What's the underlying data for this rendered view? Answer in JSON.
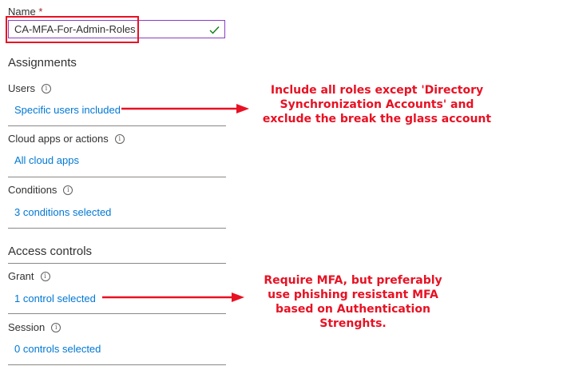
{
  "form": {
    "name_label": "Name",
    "required_mark": "*",
    "name_value": "CA-MFA-For-Admin-Roles",
    "assignments_title": "Assignments",
    "users_label": "Users",
    "users_link": "Specific users included",
    "cloud_apps_label": "Cloud apps or actions",
    "cloud_apps_link": "All cloud apps",
    "conditions_label": "Conditions",
    "conditions_link": "3 conditions selected",
    "access_controls_title": "Access controls",
    "grant_label": "Grant",
    "grant_link": "1 control selected",
    "session_label": "Session",
    "session_link": "0 controls selected"
  },
  "annotations": {
    "users_note": [
      "Include all roles except 'Directory",
      "Synchronization Accounts' and",
      "exclude the break the glass account"
    ],
    "grant_note": [
      "Require MFA, but preferably",
      "use phishing resistant MFA",
      "based on Authentication",
      "Strenghts."
    ]
  },
  "colors": {
    "link": "#0078d4",
    "annotation": "#e81123",
    "input_border": "#8a3ec4",
    "check": "#107c10"
  },
  "icons": {
    "info": "info-icon",
    "check": "checkmark-icon",
    "arrow": "arrow-right-icon"
  }
}
